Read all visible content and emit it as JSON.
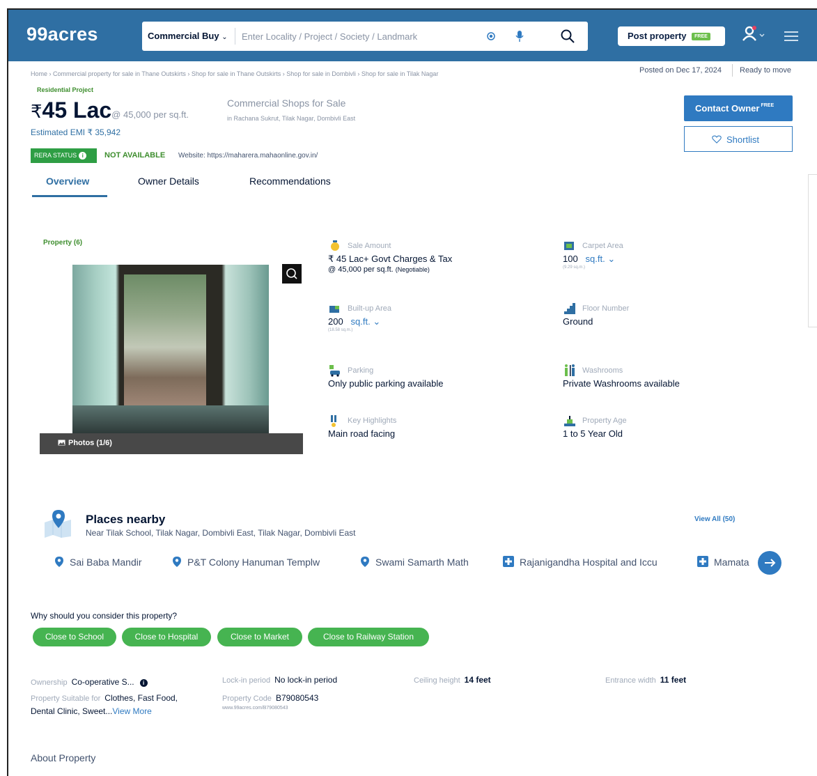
{
  "header": {
    "logo": "99acres",
    "search_category": "Commercial Buy",
    "search_placeholder": "Enter Locality / Project / Society / Landmark",
    "post_property_label": "Post property",
    "post_property_badge": "FREE"
  },
  "breadcrumb": "Home › Commercial property for sale in Thane Outskirts › Shop for sale in Thane Outskirts › Shop for sale in Dombivli › Shop for sale in Tilak Nagar",
  "posted_on": "Posted on Dec 17, 2024",
  "status": "Ready to move",
  "listing": {
    "project_type": "Residential Project",
    "currency": "₹",
    "price": "45 Lac",
    "price_per_sqft": "@ 45,000 per sq.ft.",
    "emi": "Estimated EMI ₹ 35,942",
    "title": "Commercial Shops for Sale",
    "location": "in Rachana Sukrut, Tilak Nagar, Dombivli East",
    "rera_label": "RERA STATUS",
    "rera_value": "NOT AVAILABLE",
    "website": "Website: https://maharera.mahaonline.gov.in/"
  },
  "actions": {
    "contact_owner": "Contact Owner",
    "contact_badge": "FREE",
    "shortlist": "Shortlist"
  },
  "tabs": [
    {
      "label": "Overview",
      "active": true
    },
    {
      "label": "Owner Details",
      "active": false
    },
    {
      "label": "Recommendations",
      "active": false
    }
  ],
  "gallery": {
    "label": "Property (6)",
    "photos_label": "Photos (1/6)"
  },
  "details": {
    "sale_amount": {
      "label": "Sale Amount",
      "value": "₹ 45 Lac+ Govt Charges & Tax",
      "sub": "@ 45,000 per sq.ft.",
      "sub_note": "(Negotiable)"
    },
    "carpet_area": {
      "label": "Carpet Area",
      "value": "100",
      "unit": "sq.ft.",
      "tiny": "(9.29 sq.m.)"
    },
    "built_up_area": {
      "label": "Built-up Area",
      "value": "200",
      "unit": "sq.ft.",
      "tiny": "(18.58 sq.m.)"
    },
    "floor_number": {
      "label": "Floor Number",
      "value": "Ground"
    },
    "parking": {
      "label": "Parking",
      "value": "Only public parking available"
    },
    "washrooms": {
      "label": "Washrooms",
      "value": "Private Washrooms available"
    },
    "key_highlights": {
      "label": "Key Highlights",
      "value": "Main road facing"
    },
    "property_age": {
      "label": "Property Age",
      "value": "1 to 5 Year Old"
    }
  },
  "places": {
    "title": "Places nearby",
    "subtitle": "Near Tilak School, Tilak Nagar, Dombivli East, Tilak Nagar, Dombivli East",
    "view_all": "View All (50)",
    "items": [
      {
        "name": "Sai Baba Mandir",
        "icon": "location-pin-icon"
      },
      {
        "name": "P&T Colony Hanuman Templw",
        "icon": "location-pin-icon"
      },
      {
        "name": "Swami Samarth Math",
        "icon": "location-pin-icon"
      },
      {
        "name": "Rajanigandha Hospital and Iccu",
        "icon": "hospital-icon"
      },
      {
        "name": "Mamata",
        "icon": "hospital-icon"
      }
    ]
  },
  "why_consider": {
    "title": "Why should you consider this property?",
    "chips": [
      "Close to School",
      "Close to Hospital",
      "Close to Market",
      "Close to Railway Station"
    ]
  },
  "facts": {
    "ownership": {
      "label": "Ownership",
      "value": "Co-operative S..."
    },
    "lock_in": {
      "label": "Lock-in period",
      "value": "No lock-in period"
    },
    "ceiling": {
      "label": "Ceiling height",
      "value": "14 feet"
    },
    "entrance": {
      "label": "Entrance width",
      "value": "11 feet"
    },
    "suitable_for": {
      "label": "Property Suitable for",
      "value": "Clothes, Fast Food,",
      "value2": "Dental Clinic, Sweet...",
      "more": "View More"
    },
    "property_code": {
      "label": "Property Code",
      "value": "B79080543",
      "url": "www.99acres.com/B79080543"
    }
  },
  "about_title": "About Property",
  "colors": {
    "header_bg": "#2f6fa3",
    "accent_blue": "#2f7ac1",
    "green": "#46b451"
  }
}
